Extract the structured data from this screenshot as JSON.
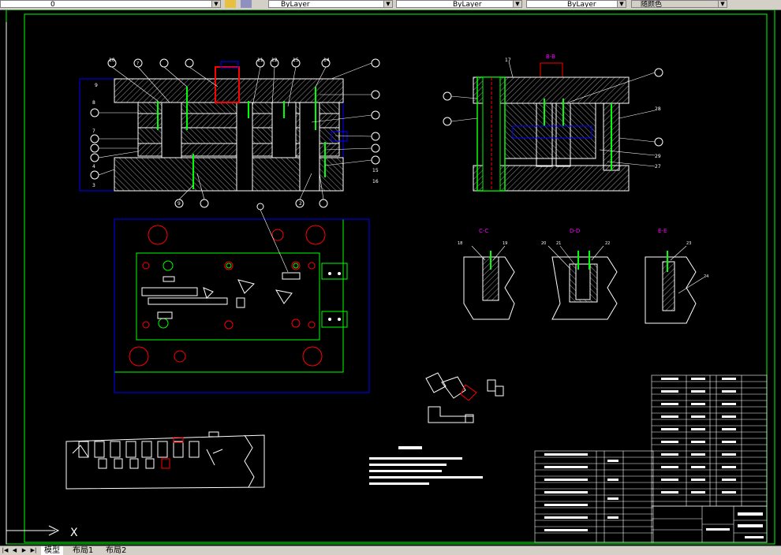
{
  "toolbar": {
    "layer_value": "0",
    "color_value": "ByLayer",
    "linetype_value": "ByLayer",
    "lineweight_value": "ByLayer",
    "plotstyle_value": "随颜色"
  },
  "tabs": {
    "model": "模型",
    "layout1": "布局1",
    "layout2": "布局2"
  },
  "ucs_label": "X",
  "section_titles": {
    "bb": "B-B",
    "cc": "C-C",
    "dd": "D-D",
    "ee": "E-E"
  },
  "part_numbers_left": [
    "9",
    "8",
    "7",
    "6",
    "5",
    "4",
    "3",
    "2",
    "1"
  ],
  "part_numbers_top": [
    "10",
    "7",
    "25",
    "38",
    "11",
    "12",
    "15",
    "14",
    "13"
  ],
  "part_numbers_right": [
    "1",
    "2",
    "3",
    "4",
    "5",
    "16",
    "18"
  ],
  "part_numbers_bottom": [
    "8",
    "9",
    "17",
    "16"
  ],
  "bb_numbers": [
    "17",
    "30",
    "31",
    "29",
    "28",
    "26",
    "25",
    "27"
  ],
  "section_numbers": [
    "18",
    "19",
    "20",
    "21",
    "22",
    "23",
    "24"
  ],
  "colors": {
    "outline": "#00ff00",
    "part": "#ffffff",
    "leader": "#ffffff",
    "red": "#ff0000",
    "blue": "#0000ff",
    "magenta": "#ff00ff",
    "cyan": "#00ffff"
  }
}
